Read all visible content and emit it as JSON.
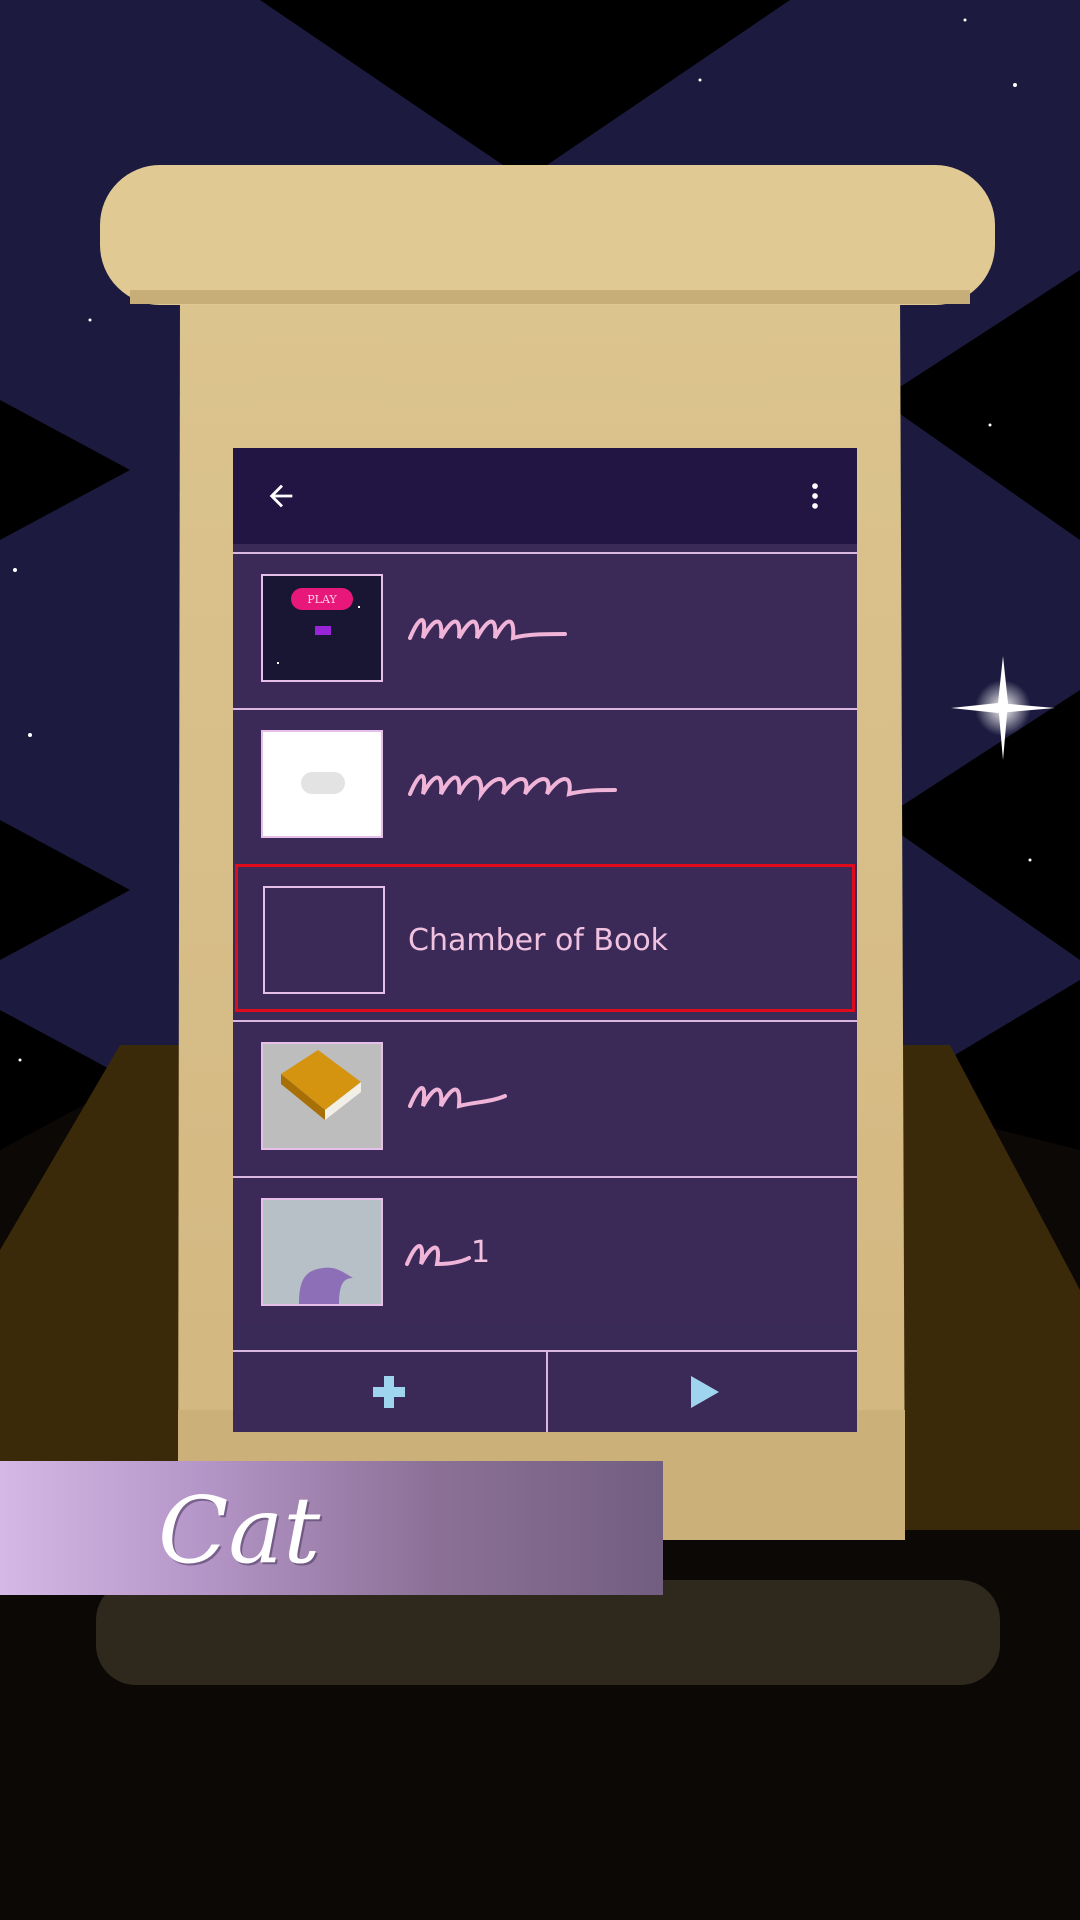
{
  "app": {
    "back_icon": "arrow-left-icon",
    "menu_icon": "more-vertical-icon"
  },
  "items": [
    {
      "label": "",
      "thumbnail": "play-screen"
    },
    {
      "label": "",
      "thumbnail": "white-cloud"
    },
    {
      "label": "Chamber of Book",
      "thumbnail": "empty",
      "selected": true
    },
    {
      "label": "",
      "thumbnail": "orange-book"
    },
    {
      "label": "1",
      "thumbnail": "purple-hat"
    }
  ],
  "thumb_texts": {
    "play": "PLAY"
  },
  "bottom_bar": {
    "add_icon": "plus-icon",
    "play_icon": "play-icon"
  },
  "banner": {
    "title": "Cat"
  },
  "colors": {
    "app_bar": "#221543",
    "list_row": "#3b2958",
    "row_border": "#d9b7df",
    "text": "#f1c2df",
    "accent": "#9fd4ee",
    "selection": "#e00b1a"
  }
}
